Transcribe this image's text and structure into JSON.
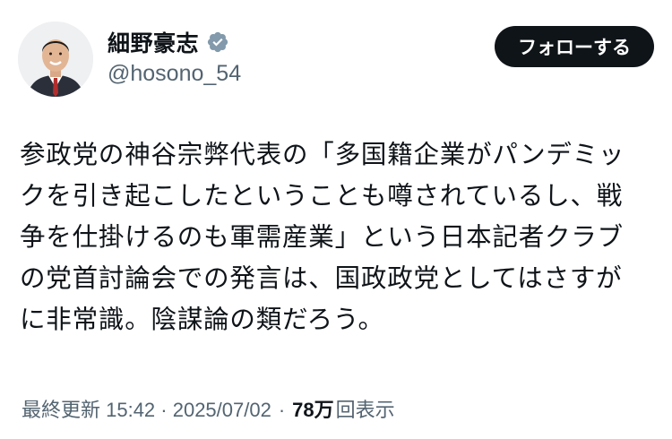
{
  "author": {
    "display_name": "細野豪志",
    "handle": "@hosono_54",
    "verified_icon": "verified-badge-icon",
    "verified_color": "#829aab"
  },
  "follow_button": {
    "label": "フォローする"
  },
  "post": {
    "text": "参政党の神谷宗弊代表の「多国籍企業がパンデミッ\nクを引き起こしたということも噂されているし、戦\n争を仕掛けるのも軍需産業」という日本記者クラブ\nの党首討論会での発言は、国政政党としてはさすが\nに非常識。陰謀論の類だろう。"
  },
  "meta": {
    "timestamp": "最終更新 15:42 · 2025/07/02",
    "separator": "·",
    "views_count": "78万",
    "views_label": "回表示"
  },
  "colors": {
    "text": "#0f1419",
    "secondary": "#536471",
    "button_bg": "#0f1419",
    "button_text": "#ffffff"
  }
}
